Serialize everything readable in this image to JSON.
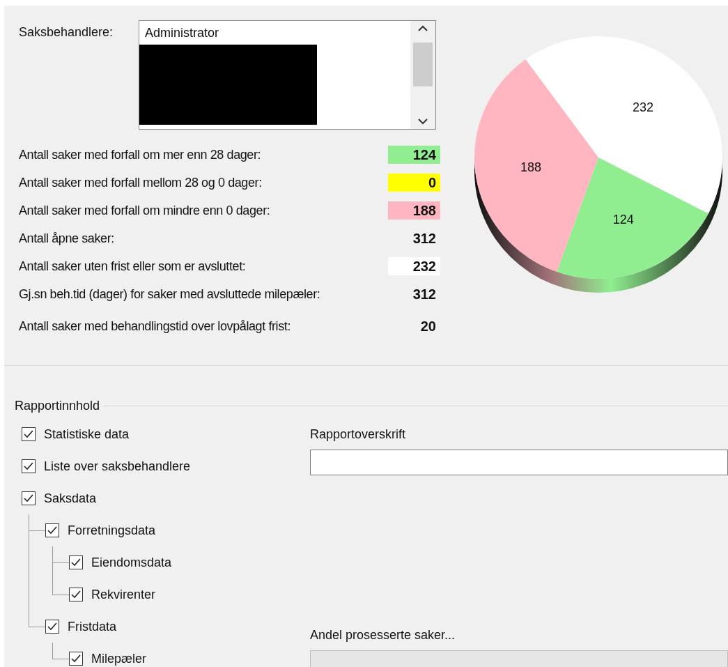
{
  "case_officers": {
    "label": "Saksbehandlere:",
    "items": [
      "Administrator"
    ]
  },
  "stats": [
    {
      "label": "Antall saker med forfall om mer enn 28 dager:",
      "value": "124",
      "color": "#90ee90"
    },
    {
      "label": "Antall saker med forfall mellom 28 og 0 dager:",
      "value": "0",
      "color": "#ffff00"
    },
    {
      "label": "Antall saker med forfall om mindre enn 0 dager:",
      "value": "188",
      "color": "#ffb6c1"
    },
    {
      "label": "Antall åpne saker:",
      "value": "312"
    },
    {
      "label": "Antall saker uten frist eller som er avsluttet:",
      "value": "232",
      "color": "#ffffff"
    },
    {
      "label": "Gj.sn beh.tid (dager) for saker med avsluttede milepæler:",
      "value": "312"
    },
    {
      "label": "Antall saker med behandlingstid over lovpålagt frist:",
      "value": "20"
    }
  ],
  "pie": {
    "chart_data": {
      "type": "pie",
      "values": [
        232,
        124,
        188
      ],
      "value_labels": [
        "232",
        "124",
        "188"
      ]
    }
  },
  "report_content": {
    "title": "Rapportinnhold",
    "options": [
      {
        "label": "Statistiske data",
        "checked": true
      },
      {
        "label": "Liste over saksbehandlere",
        "checked": true
      },
      {
        "label": "Saksdata",
        "checked": true,
        "children": [
          {
            "label": "Forretningsdata",
            "checked": true,
            "children": [
              {
                "label": "Eiendomsdata",
                "checked": true
              },
              {
                "label": "Rekvirenter",
                "checked": true
              }
            ]
          },
          {
            "label": "Fristdata",
            "checked": true,
            "children": [
              {
                "label": "Milepæler",
                "checked": true
              }
            ]
          }
        ]
      }
    ]
  },
  "report_heading": {
    "label": "Rapportoverskrift"
  },
  "progress": {
    "label": "Andel prosesserte saker...",
    "level": 0
  }
}
